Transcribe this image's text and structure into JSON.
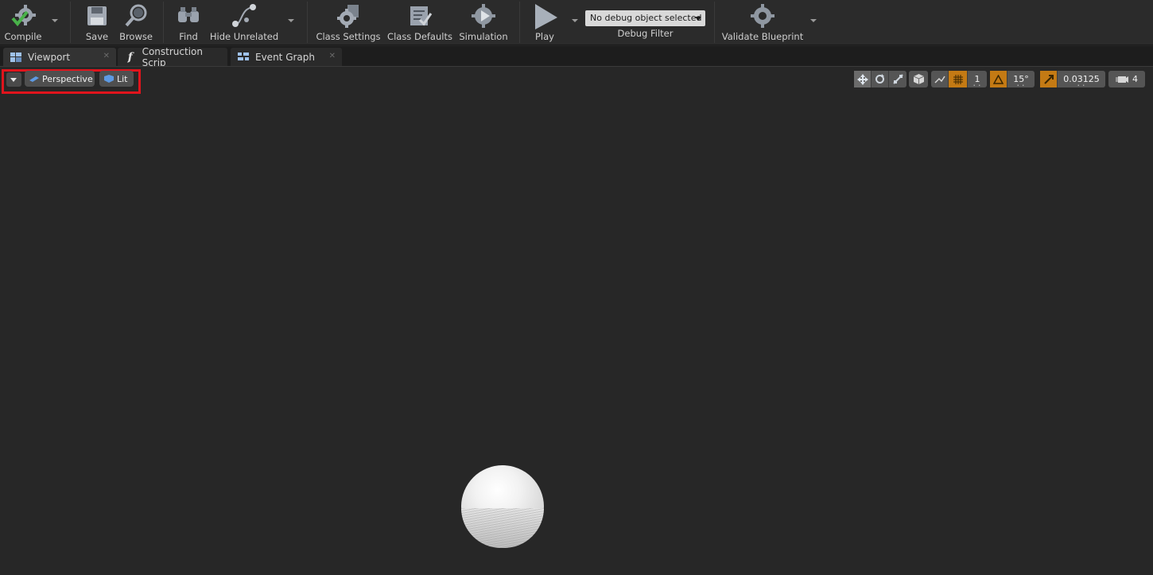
{
  "toolbar": {
    "compile": "Compile",
    "save": "Save",
    "browse": "Browse",
    "find": "Find",
    "hide_unrelated": "Hide Unrelated",
    "class_settings": "Class Settings",
    "class_defaults": "Class Defaults",
    "simulation": "Simulation",
    "play": "Play",
    "debug_object": "No debug object selected",
    "debug_filter": "Debug Filter",
    "validate_blueprint": "Validate Blueprint"
  },
  "tabs": [
    {
      "label": "Viewport",
      "active": true
    },
    {
      "label": "Construction Scrip",
      "active": false
    },
    {
      "label": "Event Graph",
      "active": false
    }
  ],
  "viewport": {
    "view_mode": "Perspective",
    "lighting": "Lit",
    "grid_snap_value": "1",
    "rotation_snap_value": "15°",
    "scale_snap_value": "0.03125",
    "camera_speed": "4"
  },
  "colors": {
    "toolbar_bg": "#2b2b2b",
    "viewport_bg": "#272727",
    "snap_active": "#c47a14",
    "highlight_frame": "#e0141c"
  }
}
